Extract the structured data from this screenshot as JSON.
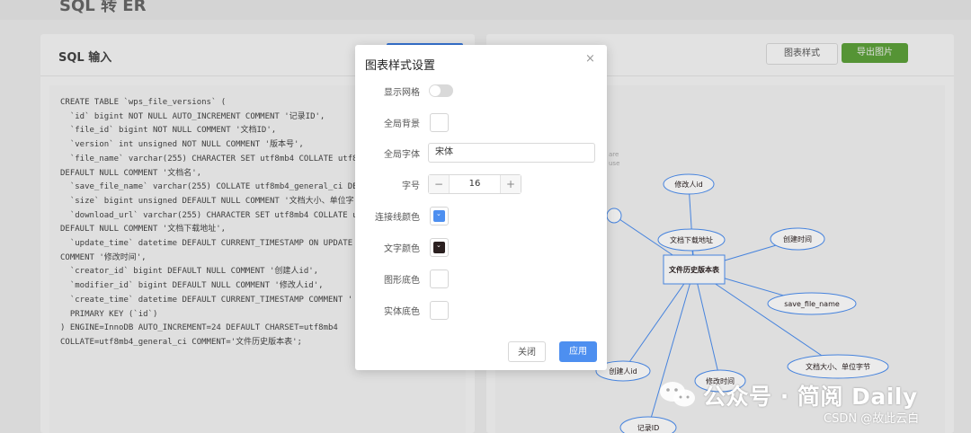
{
  "page": {
    "title": "SQL 转 ER"
  },
  "left_panel": {
    "title": "SQL 输入",
    "code_lines": [
      "CREATE TABLE `wps_file_versions` (",
      "  `id` bigint NOT NULL AUTO_INCREMENT COMMENT '记录ID',",
      "  `file_id` bigint NOT NULL COMMENT '文档ID',",
      "  `version` int unsigned NOT NULL COMMENT '版本号',",
      "  `file_name` varchar(255) CHARACTER SET utf8mb4 COLLATE utf8",
      "DEFAULT NULL COMMENT '文档名',",
      "  `save_file_name` varchar(255) COLLATE utf8mb4_general_ci DE",
      "  `size` bigint unsigned DEFAULT NULL COMMENT '文档大小、单位字",
      "  `download_url` varchar(255) CHARACTER SET utf8mb4 COLLATE u",
      "DEFAULT NULL COMMENT '文档下载地址',",
      "  `update_time` datetime DEFAULT CURRENT_TIMESTAMP ON UPDATE",
      "COMMENT '修改时间',",
      "  `creator_id` bigint DEFAULT NULL COMMENT '创建人id',",
      "  `modifier_id` bigint DEFAULT NULL COMMENT '修改人id',",
      "  `create_time` datetime DEFAULT CURRENT_TIMESTAMP COMMENT '",
      "  PRIMARY KEY (`id`)",
      ") ENGINE=InnoDB AUTO_INCREMENT=24 DEFAULT CHARSET=utf8mb4",
      "COLLATE=utf8mb4_general_ci COMMENT='文件历史版本表';"
    ]
  },
  "right_panel": {
    "style_button": "图表样式",
    "export_button": "导出图片",
    "legend": [
      "are",
      "use"
    ],
    "er": {
      "entity": "文件历史版本表",
      "attributes": [
        {
          "label": "修改人id"
        },
        {
          "label": "文档下载地址"
        },
        {
          "label": "创建时间"
        },
        {
          "label": "save_file_name"
        },
        {
          "label": "文档大小、单位字节"
        },
        {
          "label": "修改时间"
        },
        {
          "label": "创建人id"
        },
        {
          "label": "记录ID"
        },
        {
          "label": ""
        }
      ]
    }
  },
  "modal": {
    "title": "图表样式设置",
    "close_icon": "×",
    "fields": {
      "show_grid": {
        "label": "显示网格",
        "value": false
      },
      "background": {
        "label": "全局背景",
        "color": "#ffffff"
      },
      "font": {
        "label": "全局字体",
        "value": "宋体"
      },
      "font_size": {
        "label": "字号",
        "value": "16",
        "minus": "−",
        "plus": "+"
      },
      "line_color": {
        "label": "连接线颜色",
        "color": "#4d8ff0",
        "chevron": "⌄"
      },
      "text_color": {
        "label": "文字颜色",
        "color": "#2b2020",
        "chevron": "⌄"
      },
      "shape_fill": {
        "label": "图形底色",
        "color": "#ffffff"
      },
      "entity_fill": {
        "label": "实体底色",
        "color": "#ffffff"
      }
    },
    "cancel_button": "关闭",
    "apply_button": "应用"
  },
  "watermark": {
    "text": "公众号 · 简阅 Daily",
    "source": "CSDN @故此云白"
  }
}
